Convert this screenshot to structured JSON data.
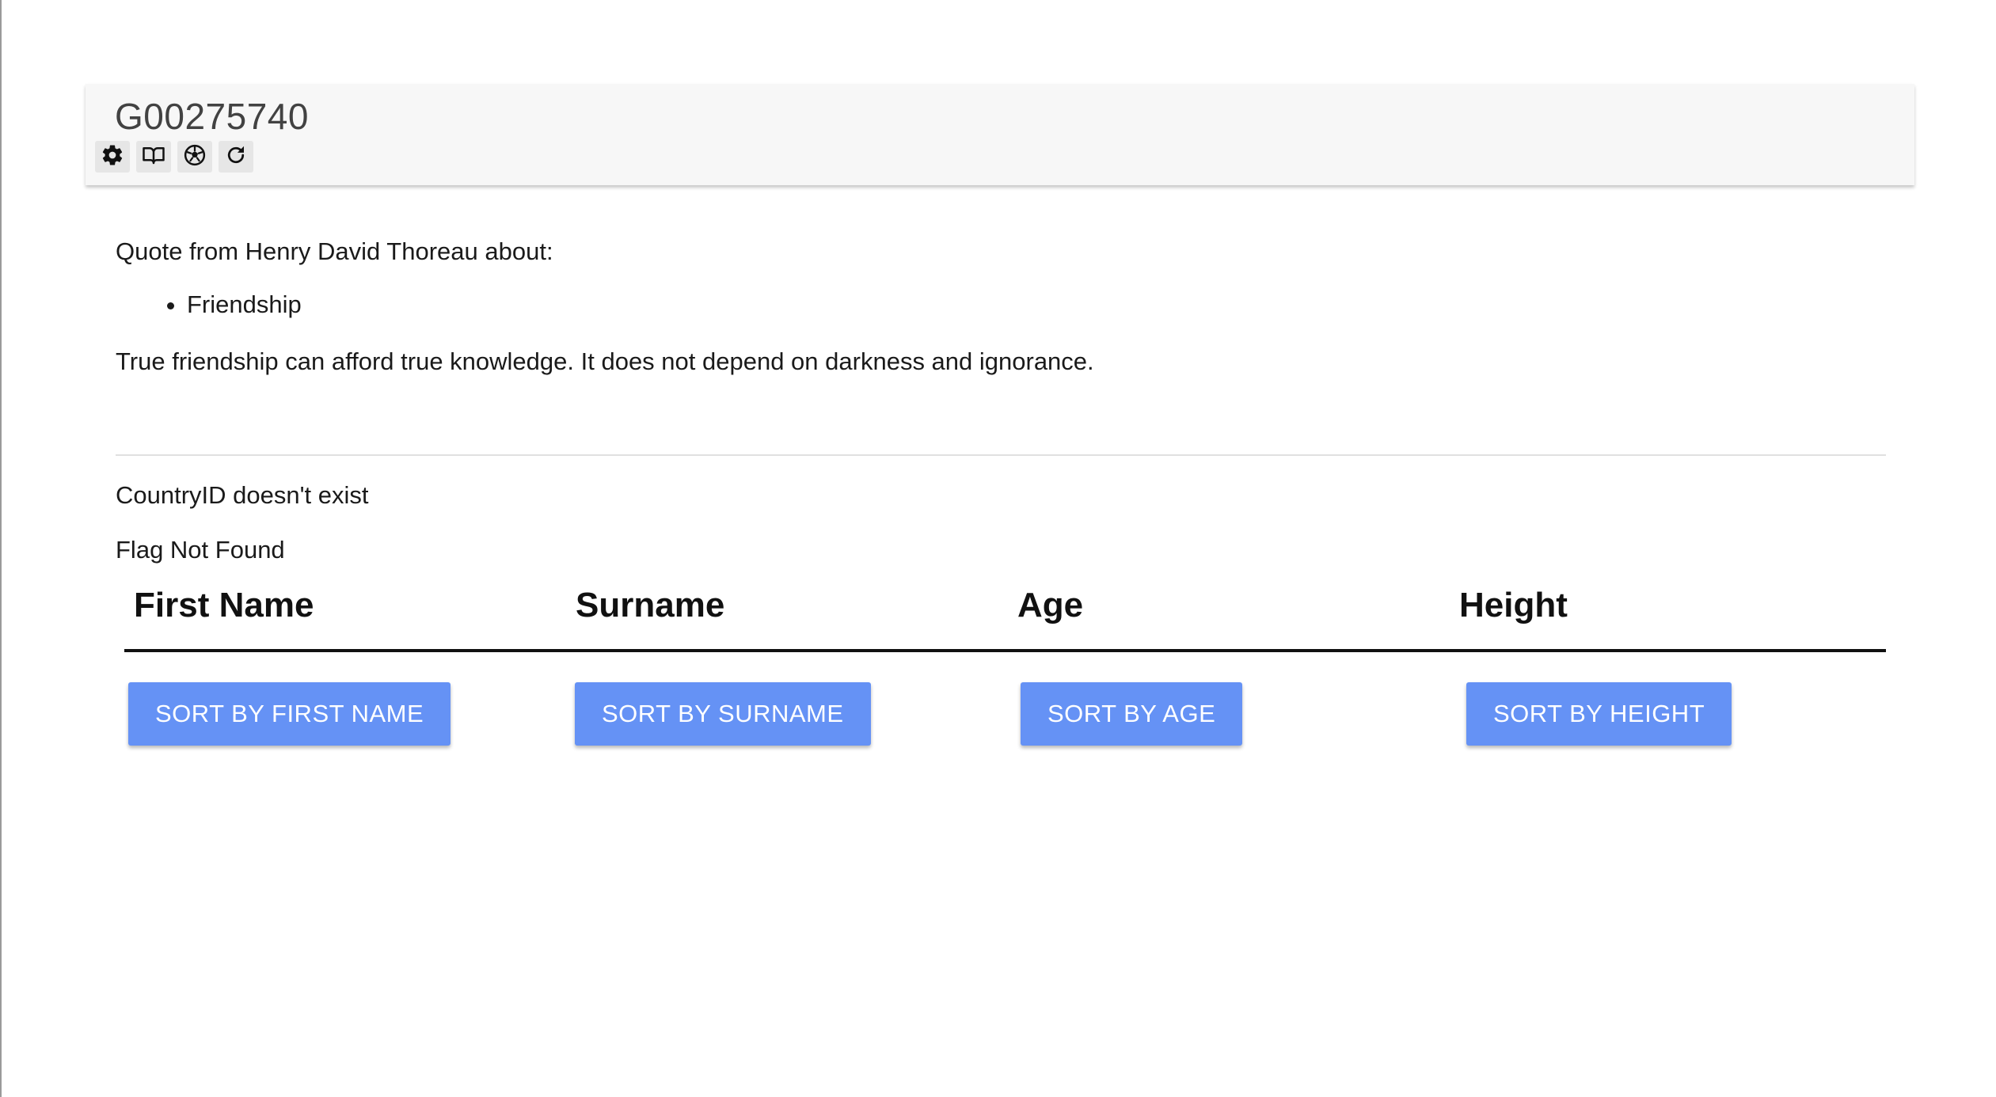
{
  "header": {
    "title": "G00275740",
    "toolbar": [
      {
        "icon": "gear-icon"
      },
      {
        "icon": "book-icon"
      },
      {
        "icon": "soccer-ball-icon"
      },
      {
        "icon": "refresh-icon"
      }
    ]
  },
  "quote_section": {
    "intro": "Quote from Henry David Thoreau about:",
    "topics": [
      "Friendship"
    ],
    "quote": "True friendship can afford true knowledge. It does not depend on darkness and ignorance."
  },
  "country_section": {
    "country_status": "CountryID doesn't exist",
    "flag_status": "Flag Not Found"
  },
  "table": {
    "columns": [
      "First Name",
      "Surname",
      "Age",
      "Height"
    ],
    "sort_buttons": [
      "SORT BY FIRST NAME",
      "SORT BY SURNAME",
      "SORT BY AGE",
      "SORT BY HEIGHT"
    ]
  },
  "colors": {
    "button_bg": "#6592f5",
    "header_bg": "#f7f7f7"
  }
}
